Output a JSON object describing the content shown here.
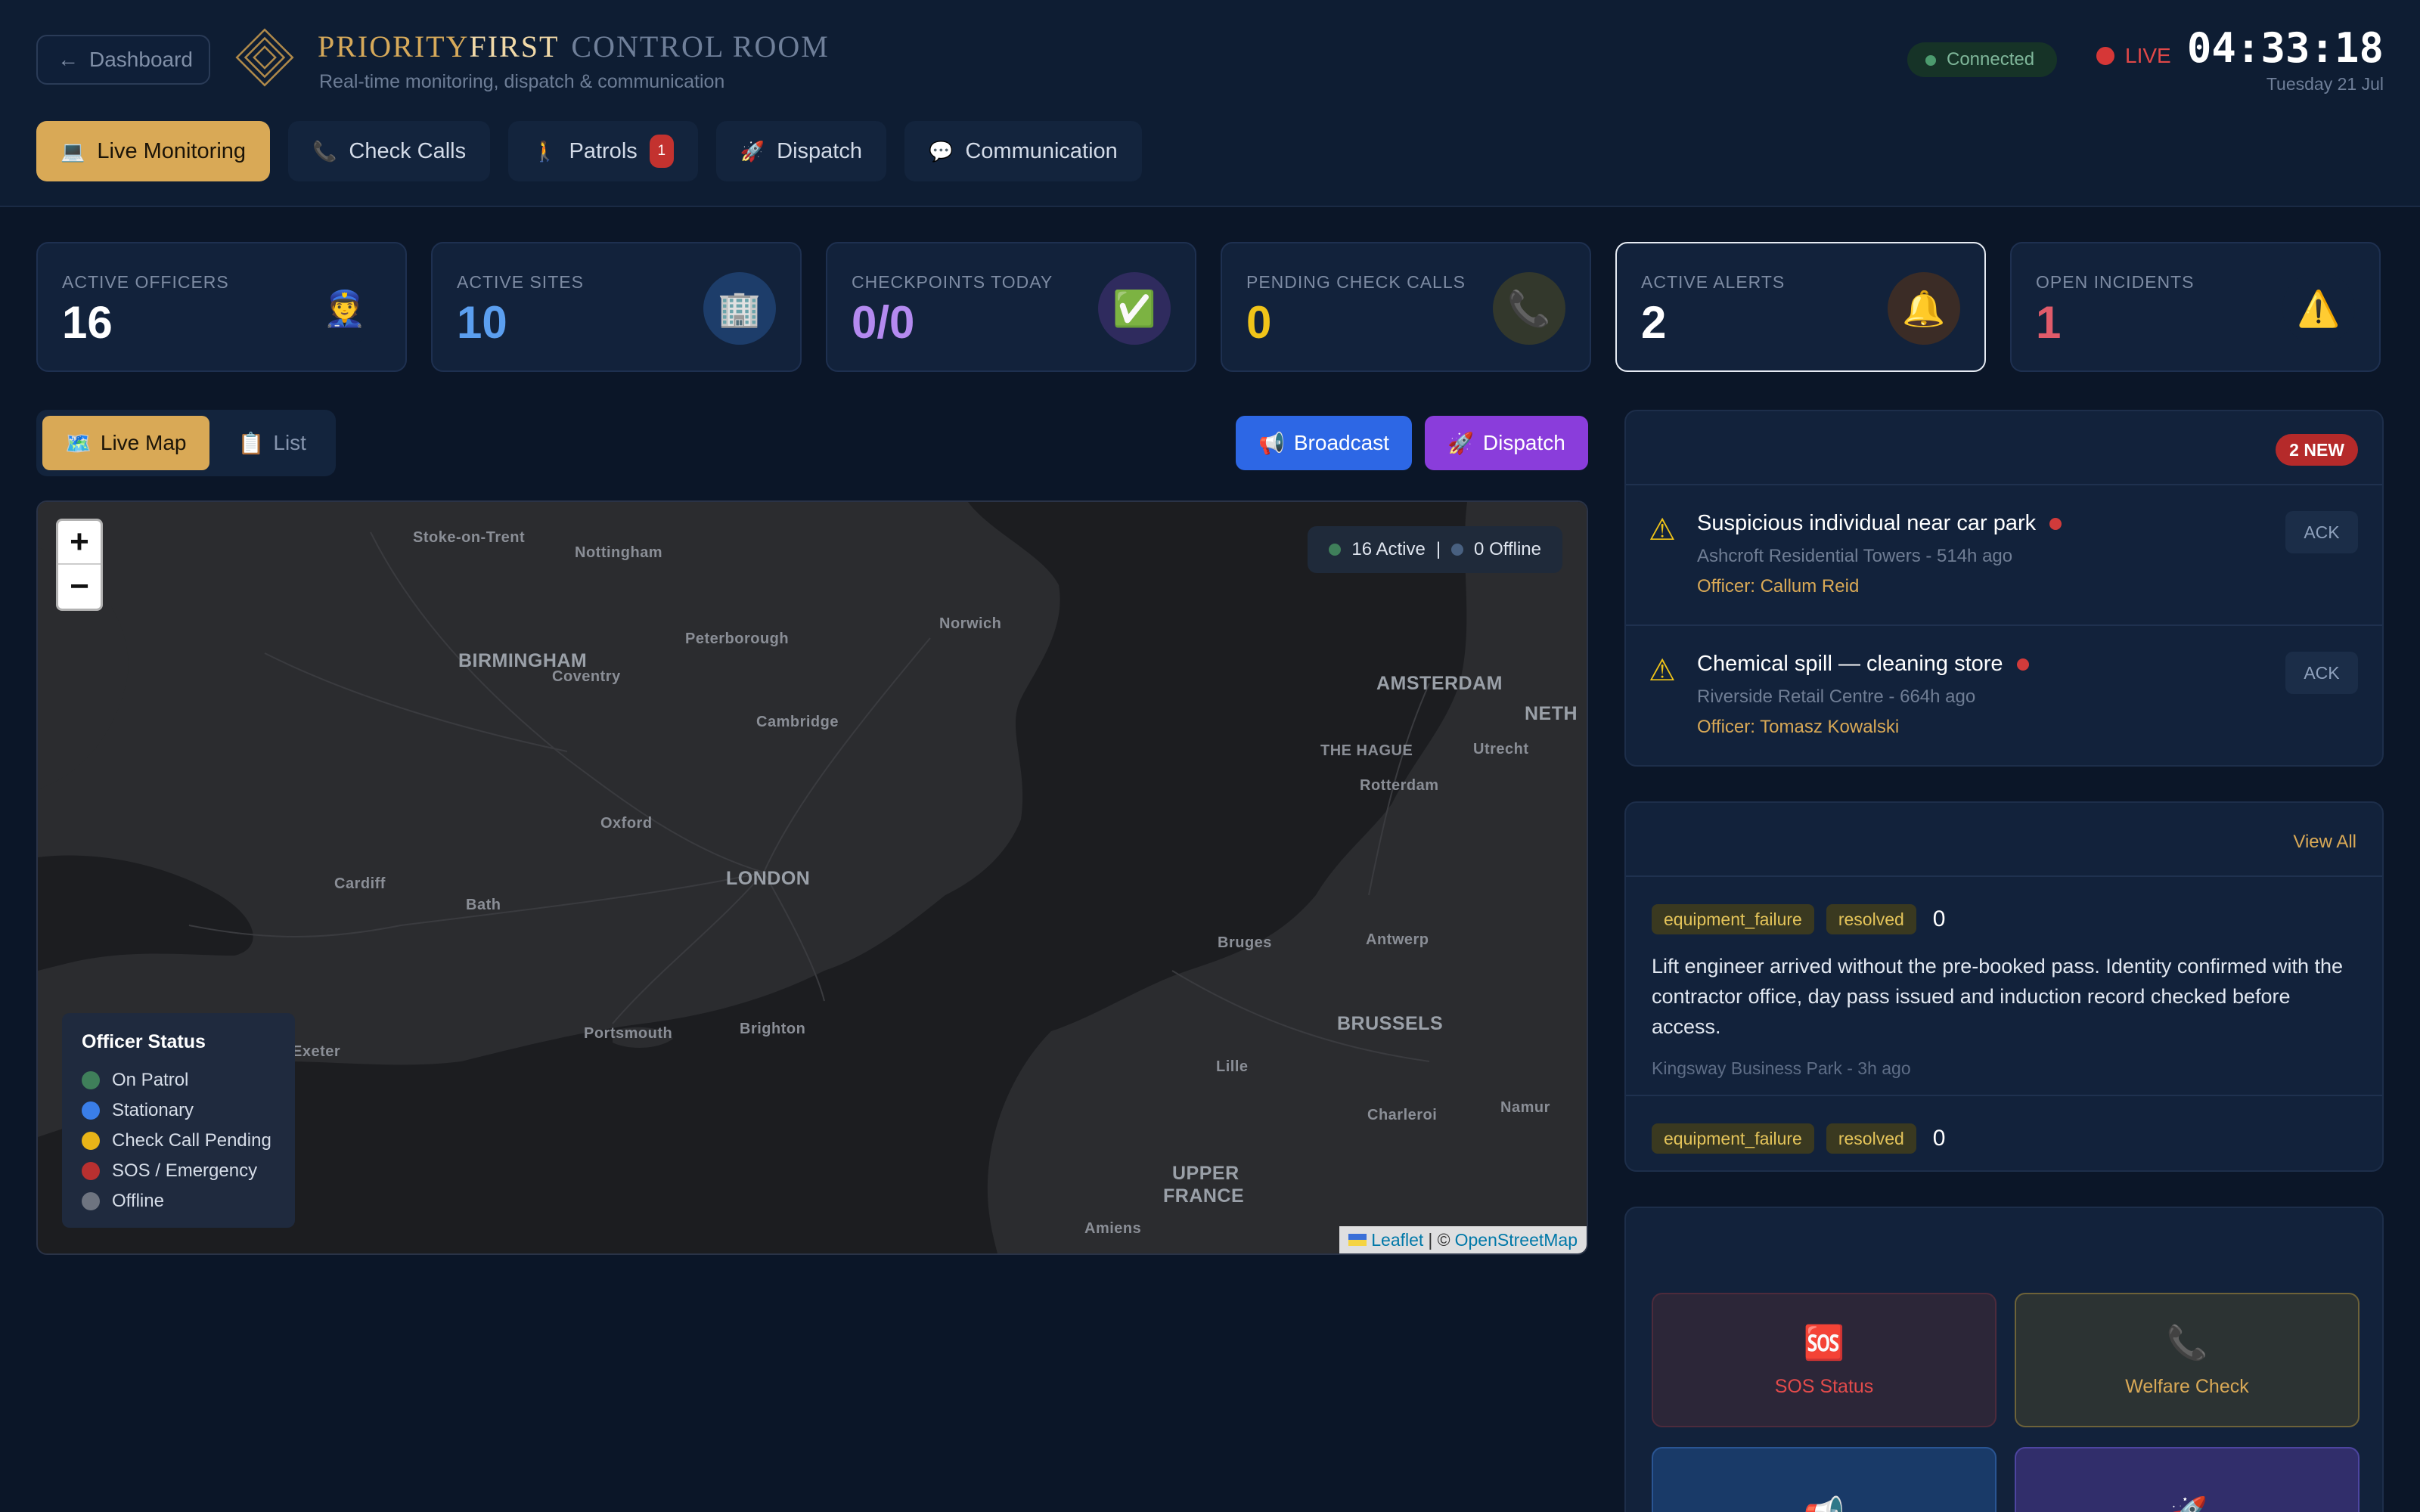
{
  "header": {
    "back_label": "Dashboard",
    "brand_part1": "PRIORITY",
    "brand_part2": "FIRST",
    "brand_part3": "CONTROL ROOM",
    "subtitle": "Real-time monitoring, dispatch & communication",
    "connection_status": "Connected",
    "live_label": "LIVE",
    "clock": "04:33:18",
    "date": "Tuesday 21 Jul"
  },
  "nav": {
    "tabs": [
      {
        "label": "Live Monitoring",
        "icon": "💻"
      },
      {
        "label": "Check Calls",
        "icon": "📞"
      },
      {
        "label": "Patrols",
        "icon": "🚶",
        "badge": "1"
      },
      {
        "label": "Dispatch",
        "icon": "🚀"
      },
      {
        "label": "Communication",
        "icon": "💬"
      }
    ]
  },
  "stats": [
    {
      "label": "ACTIVE OFFICERS",
      "value": "16",
      "icon": "👮",
      "color": "#ffffff"
    },
    {
      "label": "ACTIVE SITES",
      "value": "10",
      "icon": "🏢",
      "color": "#5b9ff0"
    },
    {
      "label": "CHECKPOINTS TODAY",
      "value": "0/0",
      "icon": "✅",
      "color": "#b48af0"
    },
    {
      "label": "PENDING CHECK CALLS",
      "value": "0",
      "icon": "📞",
      "color": "#f0c419"
    },
    {
      "label": "ACTIVE ALERTS",
      "value": "2",
      "icon": "🔔",
      "color": "#ffffff"
    },
    {
      "label": "OPEN INCIDENTS",
      "value": "1",
      "icon": "⚠️",
      "color": "#e05b6a"
    }
  ],
  "map_view": {
    "toggle_map": "Live Map",
    "toggle_map_icon": "🗺️",
    "toggle_list": "List",
    "toggle_list_icon": "📋",
    "broadcast_label": "Broadcast",
    "broadcast_icon": "📢",
    "dispatch_label": "Dispatch",
    "dispatch_icon": "🚀",
    "zoom_in": "+",
    "zoom_out": "−",
    "active_count": "16 Active",
    "separator": "|",
    "offline_count": "0 Offline",
    "attribution_leaflet": "Leaflet",
    "attribution_sep": "| ©",
    "attribution_osm": "OpenStreetMap",
    "places": [
      {
        "name": "Stoke-on-Trent"
      },
      {
        "name": "Nottingham"
      },
      {
        "name": "Norwich"
      },
      {
        "name": "Peterborough"
      },
      {
        "name": "BIRMINGHAM"
      },
      {
        "name": "Coventry"
      },
      {
        "name": "Cambridge"
      },
      {
        "name": "AMSTERDAM"
      },
      {
        "name": "NETH"
      },
      {
        "name": "THE HAGUE"
      },
      {
        "name": "Utrecht"
      },
      {
        "name": "Rotterdam"
      },
      {
        "name": "Oxford"
      },
      {
        "name": "Cardiff"
      },
      {
        "name": "LONDON"
      },
      {
        "name": "Bath"
      },
      {
        "name": "Bruges"
      },
      {
        "name": "Antwerp"
      },
      {
        "name": "BRUSSELS"
      },
      {
        "name": "Exeter"
      },
      {
        "name": "Portsmouth"
      },
      {
        "name": "Brighton"
      },
      {
        "name": "Lille"
      },
      {
        "name": "Charleroi"
      },
      {
        "name": "Namur"
      },
      {
        "name": "UPPER"
      },
      {
        "name": "FRANCE"
      },
      {
        "name": "Amiens"
      }
    ],
    "legend": {
      "title": "Officer Status",
      "items": [
        {
          "label": "On Patrol",
          "color": "#3f7f5a"
        },
        {
          "label": "Stationary",
          "color": "#3a7ee8"
        },
        {
          "label": "Check Call Pending",
          "color": "#e8b418"
        },
        {
          "label": "SOS / Emergency",
          "color": "#b83030"
        },
        {
          "label": "Offline",
          "color": "#6e7480"
        }
      ]
    }
  },
  "alerts": {
    "new_badge": "2 NEW",
    "items": [
      {
        "title": "Suspicious individual near car park",
        "meta": "Ashcroft Residential Towers - 514h ago",
        "officer": "Officer: Callum Reid",
        "ack": "ACK"
      },
      {
        "title": "Chemical spill — cleaning store",
        "meta": "Riverside Retail Centre - 664h ago",
        "officer": "Officer: Tomasz Kowalski",
        "ack": "ACK"
      }
    ]
  },
  "incidents": {
    "view_all": "View All",
    "items": [
      {
        "type": "equipment_failure",
        "status": "resolved",
        "count": "0",
        "text": "Lift engineer arrived without the pre-booked pass. Identity confirmed with the contractor office, day pass issued and induction record checked before access.",
        "meta": "Kingsway Business Park - 3h ago"
      },
      {
        "type": "equipment_failure",
        "status": "resolved",
        "count": "0"
      }
    ]
  },
  "quick_actions": [
    {
      "label": "SOS Status",
      "icon": "🆘"
    },
    {
      "label": "Welfare Check",
      "icon": "📞"
    },
    {
      "label": "",
      "icon": "📢"
    },
    {
      "label": "",
      "icon": "🚀"
    }
  ],
  "colors": {
    "accent_gold": "#d9a956",
    "background": "#0b1628",
    "panel": "#12223b",
    "alert_red": "#d13b3b",
    "broadcast_blue": "#2d67e5",
    "dispatch_purple": "#8a3ddb"
  }
}
